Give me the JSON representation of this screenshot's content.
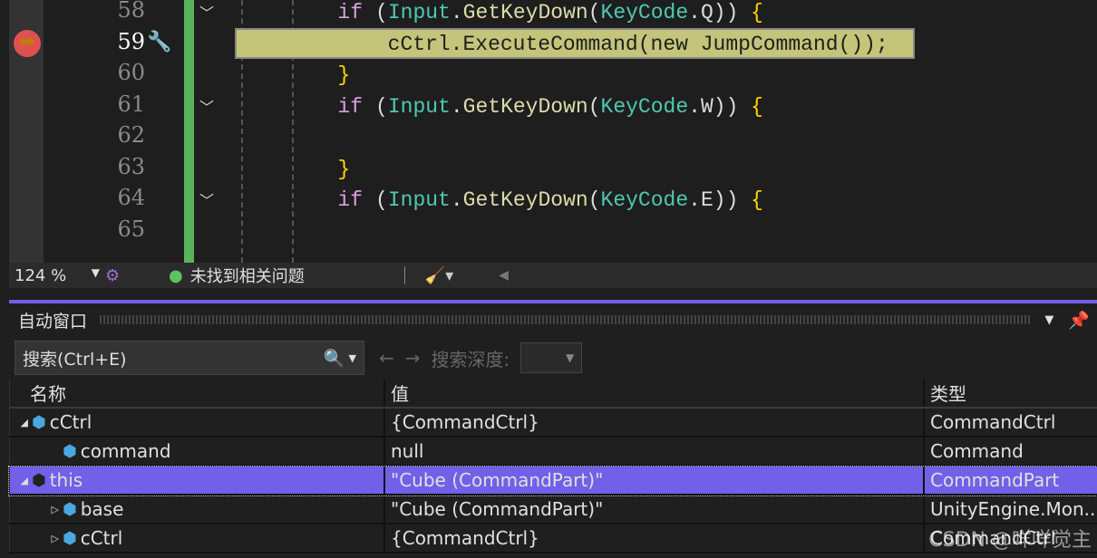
{
  "editor": {
    "lines": [
      {
        "n": "58",
        "fold": true,
        "code": [
          [
            "kw",
            "if"
          ],
          [
            "",
            "("
          ],
          [
            "ty",
            "Input"
          ],
          [
            "",
            "."
          ],
          [
            "fn",
            "GetKeyDown"
          ],
          [
            "",
            "("
          ],
          [
            "ty",
            "KeyCode"
          ],
          [
            "",
            "."
          ],
          [
            "",
            "Q"
          ],
          [
            "",
            "))"
          ],
          [
            "br",
            " {"
          ]
        ],
        "indent": "        "
      },
      {
        "n": "59",
        "current": true,
        "code": [
          [
            "",
            "cCtrl."
          ],
          [
            "fn",
            "ExecuteCommand"
          ],
          [
            "",
            "("
          ],
          [
            "",
            "new "
          ],
          [
            "",
            "JumpCommand"
          ],
          [
            "",
            "());"
          ]
        ],
        "indent": "            "
      },
      {
        "n": "60",
        "code": [
          [
            "br",
            "}"
          ]
        ],
        "indent": "        "
      },
      {
        "n": "61",
        "fold": true,
        "code": [
          [
            "kw",
            "if"
          ],
          [
            "",
            "("
          ],
          [
            "ty",
            "Input"
          ],
          [
            "",
            "."
          ],
          [
            "fn",
            "GetKeyDown"
          ],
          [
            "",
            "("
          ],
          [
            "ty",
            "KeyCode"
          ],
          [
            "",
            "."
          ],
          [
            "",
            "W"
          ],
          [
            "",
            "))"
          ],
          [
            "br",
            " {"
          ]
        ],
        "indent": "        "
      },
      {
        "n": "62",
        "code": [],
        "indent": ""
      },
      {
        "n": "63",
        "code": [
          [
            "br",
            "}"
          ]
        ],
        "indent": "        "
      },
      {
        "n": "64",
        "fold": true,
        "code": [
          [
            "kw",
            "if"
          ],
          [
            "",
            "("
          ],
          [
            "ty",
            "Input"
          ],
          [
            "",
            "."
          ],
          [
            "fn",
            "GetKeyDown"
          ],
          [
            "",
            "("
          ],
          [
            "ty",
            "KeyCode"
          ],
          [
            "",
            "."
          ],
          [
            "",
            "E"
          ],
          [
            "",
            "))"
          ],
          [
            "br",
            " {"
          ]
        ],
        "indent": "        "
      },
      {
        "n": "65",
        "code": [],
        "indent": ""
      }
    ]
  },
  "status": {
    "zoom": "124 %",
    "issues": "未找到相关问题"
  },
  "autos": {
    "title": "自动窗口",
    "search_placeholder": "搜索(Ctrl+E)",
    "depth_label": "搜索深度:",
    "columns": [
      "名称",
      "值",
      "类型"
    ],
    "rows": [
      {
        "name": "cCtrl",
        "value": "{CommandCtrl}",
        "type": "CommandCtrl",
        "level": 0,
        "expander": "expanded",
        "icon": "locked-field-icon"
      },
      {
        "name": "command",
        "value": "null",
        "type": "Command",
        "level": 1,
        "expander": "none",
        "icon": "locked-field-icon"
      },
      {
        "name": "this",
        "value": "\"Cube (CommandPart)\"",
        "type": "CommandPart",
        "level": 0,
        "expander": "expanded",
        "icon": "object-icon",
        "selected": true
      },
      {
        "name": "base",
        "value": "\"Cube (CommandPart)\"",
        "type": "UnityEngine.Mon...",
        "level": 1,
        "expander": "collapsed",
        "icon": "object-icon"
      },
      {
        "name": "cCtrl",
        "value": "{CommandCtrl}",
        "type": "CommandCtrl",
        "level": 1,
        "expander": "collapsed",
        "icon": "locked-field-icon"
      }
    ]
  },
  "watermark": "CSDN @咩咩觉主",
  "colors": {
    "accent": "#7160e8",
    "current_line": "#c4c47a",
    "change_bar": "#57b45a"
  }
}
